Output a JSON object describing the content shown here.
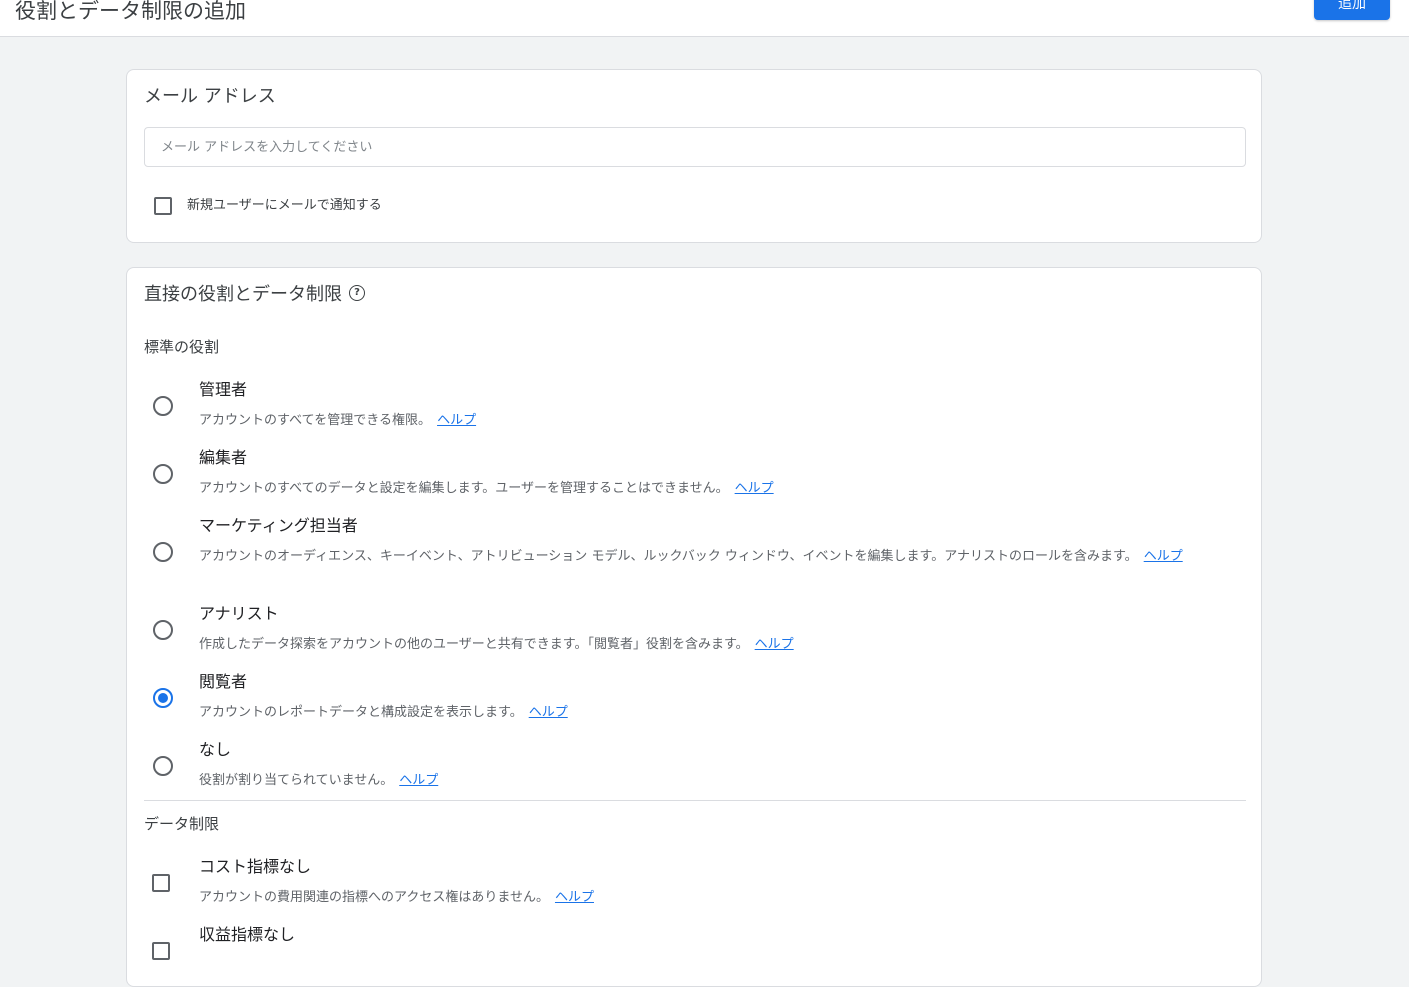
{
  "header": {
    "title": "役割とデータ制限の追加",
    "add_button": "追加"
  },
  "email_card": {
    "title": "メール アドレス",
    "input_placeholder": "メール アドレスを入力してください",
    "input_value": "",
    "notify_label": "新規ユーザーにメールで通知する",
    "notify_checked": false
  },
  "roles_card": {
    "title": "直接の役割とデータ制限",
    "standard_roles_label": "標準の役割",
    "help_link": "ヘルプ",
    "roles": [
      {
        "title": "管理者",
        "desc": "アカウントのすべてを管理できる権限。",
        "selected": false
      },
      {
        "title": "編集者",
        "desc": "アカウントのすべてのデータと設定を編集します。ユーザーを管理することはできません。",
        "selected": false
      },
      {
        "title": "マーケティング担当者",
        "desc": "アカウントのオーディエンス、キーイベント、アトリビューション モデル、ルックバック ウィンドウ、イベントを編集します。アナリストのロールを含みます。",
        "selected": false
      },
      {
        "title": "アナリスト",
        "desc": "作成したデータ探索をアカウントの他のユーザーと共有できます。「閲覧者」役割を含みます。",
        "selected": false
      },
      {
        "title": "閲覧者",
        "desc": "アカウントのレポートデータと構成設定を表示します。",
        "selected": true
      },
      {
        "title": "なし",
        "desc": "役割が割り当てられていません。",
        "selected": false
      }
    ],
    "data_restrictions_label": "データ制限",
    "restrictions": [
      {
        "title": "コスト指標なし",
        "desc": "アカウントの費用関連の指標へのアクセス権はありません。",
        "checked": false
      },
      {
        "title": "収益指標なし",
        "desc": "",
        "checked": false
      }
    ]
  },
  "colors": {
    "accent": "#1a73e8",
    "background": "#f1f3f4"
  }
}
